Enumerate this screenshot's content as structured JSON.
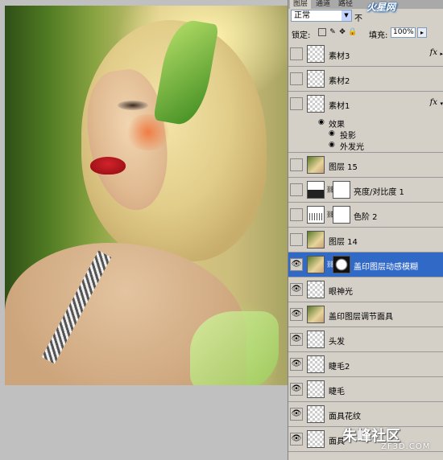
{
  "panel": {
    "tabs": [
      "图层",
      "通道",
      "路径"
    ],
    "blend_mode": "正常",
    "opacity_label": "不",
    "lock_label": "锁定:",
    "lock_icons": [
      "lock-transparent-icon",
      "lock-brush-icon",
      "lock-move-icon",
      "lock-all-icon"
    ],
    "fill_label": "填充:",
    "fill_value": "100%",
    "layers": [
      {
        "name": "素材3",
        "thumb": "transparent",
        "fx": "fx",
        "visible": false
      },
      {
        "name": "素材2",
        "thumb": "transparent",
        "visible": false
      },
      {
        "name": "素材1",
        "thumb": "transparent",
        "fx": "fx",
        "visible": false
      },
      {
        "name": "图层 15",
        "thumb": "photo",
        "visible": false
      },
      {
        "name": "亮度/对比度 1",
        "thumb": "adjustment",
        "mask": "white",
        "visible": false
      },
      {
        "name": "色阶 2",
        "thumb": "levels",
        "mask": "white",
        "visible": false
      },
      {
        "name": "图层 14",
        "thumb": "photo",
        "visible": false
      },
      {
        "name": "盖印图层动感模糊",
        "thumb": "photo",
        "mask": "dark",
        "visible": true,
        "selected": true
      },
      {
        "name": "眼神光",
        "thumb": "transparent",
        "visible": true
      },
      {
        "name": "盖印图层调节面具",
        "thumb": "photo",
        "visible": true
      },
      {
        "name": "头发",
        "thumb": "transparent",
        "visible": true
      },
      {
        "name": "睫毛2",
        "thumb": "transparent",
        "visible": true
      },
      {
        "name": "睫毛",
        "thumb": "transparent",
        "visible": true
      },
      {
        "name": "面具花纹",
        "thumb": "transparent",
        "visible": true
      },
      {
        "name": "面具",
        "thumb": "transparent",
        "visible": true
      }
    ],
    "effects": {
      "header": "效果",
      "items": [
        "投影",
        "外发光"
      ]
    }
  },
  "watermarks": {
    "top": "火星网",
    "bottom": "朱峰社区",
    "bottom_sub": "ZF3D.COM"
  }
}
